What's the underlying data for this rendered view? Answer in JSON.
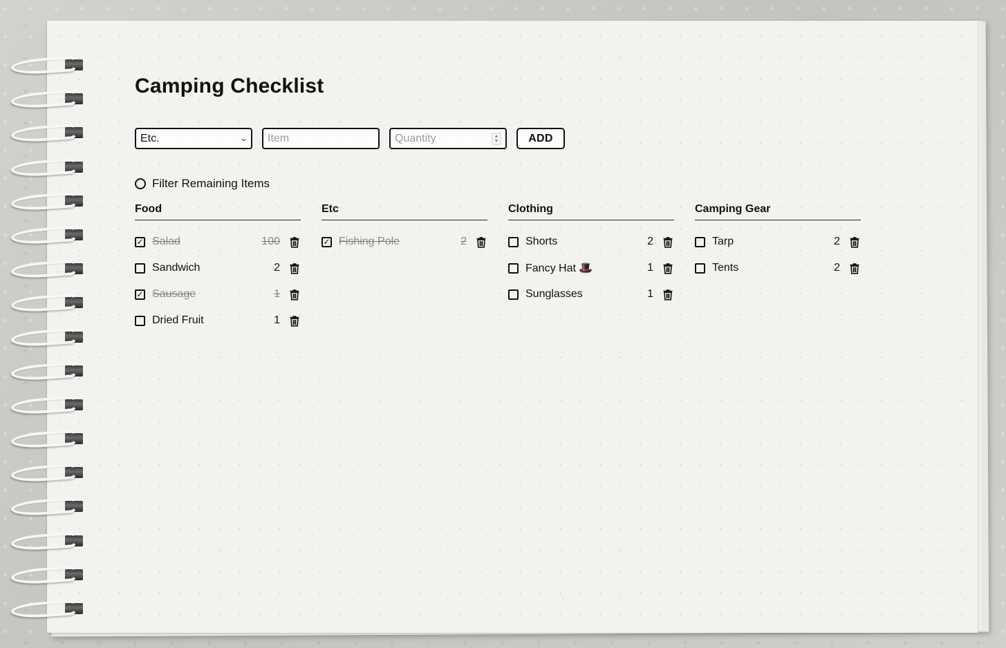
{
  "title": "Camping Checklist",
  "form": {
    "category_value": "Etc.",
    "item_placeholder": "Item",
    "quantity_placeholder": "Quantity",
    "add_label": "ADD"
  },
  "filter": {
    "label": "Filter Remaining Items",
    "checked": false
  },
  "categories": [
    {
      "name": "Food",
      "items": [
        {
          "label": "Salad",
          "qty": "100",
          "checked": true
        },
        {
          "label": "Sandwich",
          "qty": "2",
          "checked": false
        },
        {
          "label": "Sausage",
          "qty": "1",
          "checked": true
        },
        {
          "label": "Dried Fruit",
          "qty": "1",
          "checked": false
        }
      ]
    },
    {
      "name": "Etc",
      "items": [
        {
          "label": "Fishing Pole",
          "qty": "2",
          "checked": true
        }
      ]
    },
    {
      "name": "Clothing",
      "items": [
        {
          "label": "Shorts",
          "qty": "2",
          "checked": false
        },
        {
          "label": "Fancy Hat 🎩",
          "qty": "1",
          "checked": false
        },
        {
          "label": "Sunglasses",
          "qty": "1",
          "checked": false
        }
      ]
    },
    {
      "name": "Camping Gear",
      "items": [
        {
          "label": "Tarp",
          "qty": "2",
          "checked": false
        },
        {
          "label": "Tents",
          "qty": "2",
          "checked": false
        }
      ]
    }
  ]
}
